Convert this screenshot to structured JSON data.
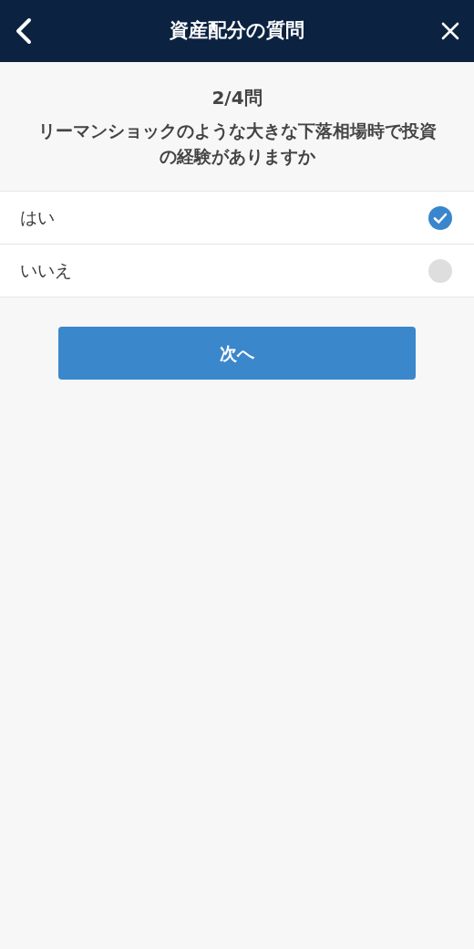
{
  "header": {
    "title": "資産配分の質問"
  },
  "progress": "2/4問",
  "question": "リーマンショックのような大きな下落相場時で投資の経験がありますか",
  "options": [
    {
      "label": "はい",
      "selected": true
    },
    {
      "label": "いいえ",
      "selected": false
    }
  ],
  "next_button": "次へ"
}
